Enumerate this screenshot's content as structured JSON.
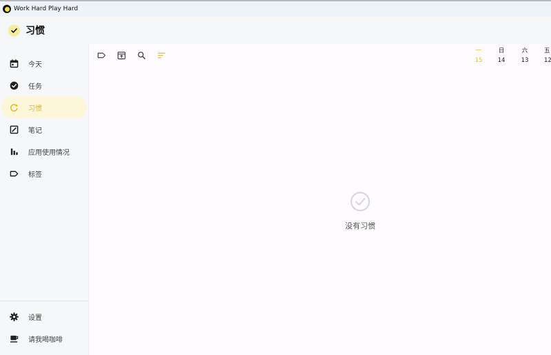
{
  "window": {
    "title": "Work Hard Play Hard"
  },
  "header": {
    "title": "习惯"
  },
  "sidebar": {
    "items": [
      {
        "label": "今天",
        "icon": "calendar-icon"
      },
      {
        "label": "任务",
        "icon": "check-circle-icon"
      },
      {
        "label": "习惯",
        "icon": "refresh-icon",
        "active": true
      },
      {
        "label": "笔记",
        "icon": "note-edit-icon"
      },
      {
        "label": "应用使用情况",
        "icon": "bar-chart-icon"
      },
      {
        "label": "标签",
        "icon": "tag-icon"
      }
    ],
    "bottom_items": [
      {
        "label": "设置",
        "icon": "gear-icon"
      },
      {
        "label": "请我喝咖啡",
        "icon": "coffee-icon"
      }
    ]
  },
  "toolbar": {
    "icons": [
      "tag-icon",
      "archive-icon",
      "search-icon",
      "sort-icon"
    ]
  },
  "days": [
    {
      "name": "一",
      "num": "15",
      "today": true
    },
    {
      "name": "日",
      "num": "14"
    },
    {
      "name": "六",
      "num": "13"
    },
    {
      "name": "五",
      "num": "12"
    }
  ],
  "empty_state": {
    "text": "没有习惯",
    "icon": "check-circle-outline-icon"
  },
  "colors": {
    "accent": "#e6bc35",
    "active_bg": "#fdf6d8",
    "sidebar_bg": "#f5f7f8",
    "content_bg": "#fdfbfd"
  }
}
